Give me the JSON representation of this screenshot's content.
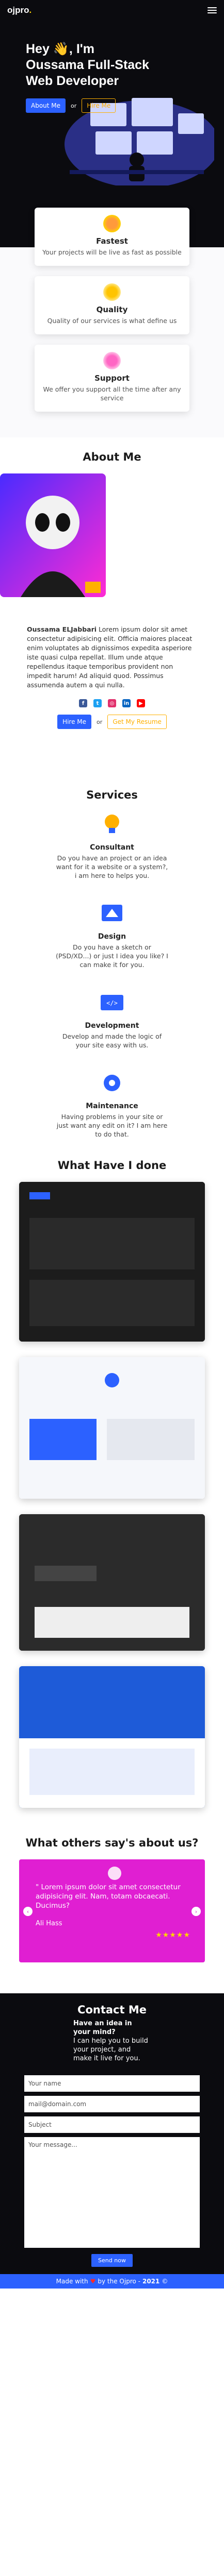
{
  "nav": {
    "logo": "ojpro",
    "logo_dot": "."
  },
  "hero": {
    "heading": "Hey 👋, I'm Oussama Full-Stack Web Developer",
    "primary_btn": "About Me",
    "or": "or",
    "secondary_btn": "Hire Me"
  },
  "features": [
    {
      "title": "Fastest",
      "text": "Your projects will be live as fast as possible"
    },
    {
      "title": "Quality",
      "text": "Quality of our services is what define us"
    },
    {
      "title": "Support",
      "text": "We offer you support all the time after any service"
    }
  ],
  "about": {
    "title": "About Me",
    "name": "Oussama ELJabbari",
    "bio": "Lorem ipsum dolor sit amet consectetur adipisicing elit. Officia maiores placeat enim voluptates ab dignissimos expedita asperiore iste quasi culpa repellat. Illum unde atque repellendus itaque temporibus provident non impedit harum! Ad aliquid quod. Possimus assumenda autem a qui nulla.",
    "hire_btn": "Hire Me",
    "or": "or",
    "portfolio_btn": "Get My Resume"
  },
  "services": {
    "title": "Services",
    "items": [
      {
        "title": "Consultant",
        "text": "Do you have an project or an idea want for it a website or a system?, i am here to helps you."
      },
      {
        "title": "Design",
        "text": "Do you have a sketch or (PSD/XD...) or just I idea you like? I can make it for you."
      },
      {
        "title": "Development",
        "text": "Develop and made the logic of your site easy with us."
      },
      {
        "title": "Maintenance",
        "text": "Having problems in your site or just want any edit on it? I am here to do that."
      }
    ]
  },
  "portfolio": {
    "title": "What Have I done"
  },
  "testimonials": {
    "title": "What others say's about us?",
    "quote": "\" Lorem ipsum dolor sit amet consectetur adipisicing elit. Nam, totam obcaecati. Ducimus?",
    "author": "Ali Hass",
    "stars": "★★★★★"
  },
  "contact": {
    "title": "Contact Me",
    "subtitle_bold": "Have an idea in your mind?",
    "subtitle": "I can help you to build your project, and make it live for you.",
    "name_placeholder": "Your name",
    "email_placeholder": "mail@domain.com",
    "subject_placeholder": "Subject",
    "message_placeholder": "Your message...",
    "send_btn": "Send now"
  },
  "footer": {
    "made": "Made with",
    "heart": "♥",
    "by": "by the Ojpro -",
    "year": "2021",
    "copyright": "©"
  },
  "colors": {
    "accent": "#2c61ff",
    "gold": "#ffb000",
    "testimonial": "#e01fd2",
    "dark": "#0b0b0f"
  }
}
